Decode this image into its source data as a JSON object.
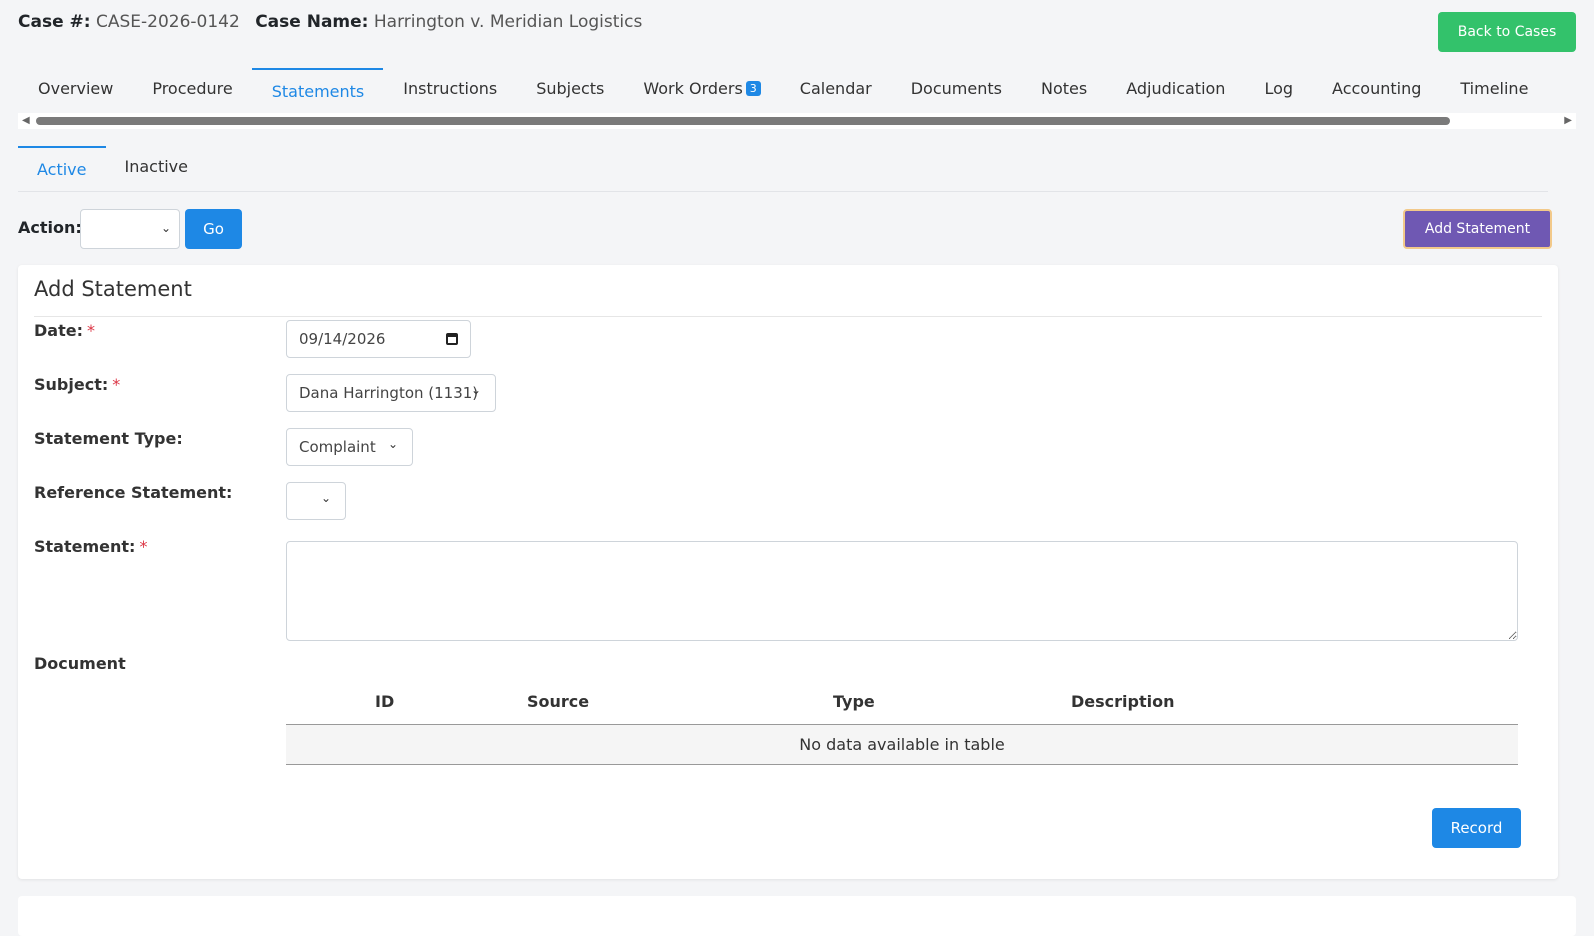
{
  "header": {
    "case_no_label": "Case #:",
    "case_no": "CASE-2026-0142",
    "case_name_label": "Case Name:",
    "case_name": "Harrington v. Meridian Logistics",
    "back_label": "Back to Cases"
  },
  "tabs": {
    "overview": "Overview",
    "procedure": "Procedure",
    "statements": "Statements",
    "instructions": "Instructions",
    "subjects": "Subjects",
    "work_orders": "Work Orders",
    "work_orders_badge": "3",
    "calendar": "Calendar",
    "documents": "Documents",
    "notes": "Notes",
    "adjudication": "Adjudication",
    "log": "Log",
    "accounting": "Accounting",
    "timeline": "Timeline"
  },
  "subtabs": {
    "active": "Active",
    "inactive": "Inactive"
  },
  "toolbar": {
    "action_label": "Action:",
    "go_label": "Go",
    "add_label": "Add Statement"
  },
  "form": {
    "title": "Add Statement",
    "date_label": "Date:",
    "date_value": "09/14/2026",
    "subject_label": "Subject:",
    "subject_value": "Dana Harrington (1131)",
    "type_label": "Statement Type:",
    "type_value": "Complaint",
    "reference_label": "Reference Statement:",
    "statement_label": "Statement:",
    "required_mark": "*",
    "document_label": "Document",
    "record_label": "Record"
  },
  "doc_table": {
    "columns": [
      "ID",
      "Source",
      "Type",
      "Description"
    ],
    "empty_text": "No data available in table"
  },
  "colors": {
    "accent": "#1e88e5",
    "success": "#33c26b",
    "purple": "#6f58b3",
    "required": "#dc3545"
  }
}
